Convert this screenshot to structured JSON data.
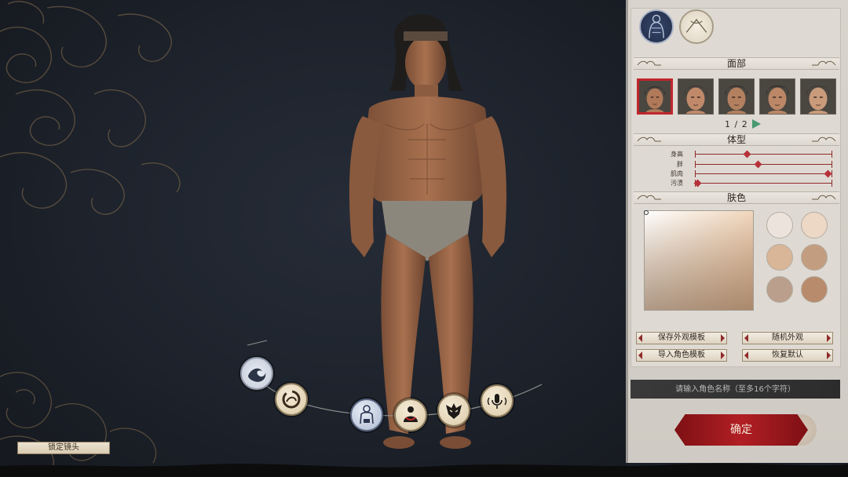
{
  "scene": {
    "lock_camera_label": "锁定镜头",
    "categories": [
      {
        "icon": "wave-icon",
        "active": false
      },
      {
        "icon": "ink-circle-icon",
        "active": false
      },
      {
        "icon": "body-icon",
        "active": true
      },
      {
        "icon": "hair-icon",
        "active": false
      },
      {
        "icon": "mask-icon",
        "active": false
      },
      {
        "icon": "voice-icon",
        "active": false
      }
    ]
  },
  "panel": {
    "modes": [
      {
        "icon": "body-mode-icon",
        "active": true
      },
      {
        "icon": "skin-mode-icon",
        "active": false
      }
    ],
    "face_section": {
      "title": "面部",
      "faces": [
        {
          "selected": true,
          "skin": "#b07a5a",
          "hair": "#2a2521"
        },
        {
          "selected": false,
          "skin": "#c08a6a",
          "hair": "#3a3330"
        },
        {
          "selected": false,
          "skin": "#b3805f",
          "hair": "#2c2724"
        },
        {
          "selected": false,
          "skin": "#bb8767",
          "hair": "#2a2522"
        },
        {
          "selected": false,
          "skin": "#c99b7b",
          "hair": "#3b3531"
        }
      ],
      "page": "1 / 2"
    },
    "body_section": {
      "title": "体型",
      "sliders": [
        {
          "label": "身高",
          "value": 0.38
        },
        {
          "label": "胖",
          "value": 0.46
        },
        {
          "label": "肌肉",
          "value": 0.97
        },
        {
          "label": "污渍",
          "value": 0.02
        }
      ]
    },
    "skin_section": {
      "title": "肤色",
      "swatches": [
        "#ece3dc",
        "#edd7c5",
        "#d9b697",
        "#c39d80",
        "#b99f8c",
        "#b88b6c"
      ]
    },
    "actions": {
      "save_template": "保存外观模板",
      "random_look": "随机外观",
      "import_template": "导入角色模板",
      "reset_default": "恢复默认"
    },
    "name_input": {
      "placeholder": "请输入角色名称（至多16个字符）",
      "value": ""
    },
    "confirm_label": "确定"
  },
  "colors": {
    "accent_red": "#b11f24",
    "panel_bg": "#d8d4cd"
  }
}
